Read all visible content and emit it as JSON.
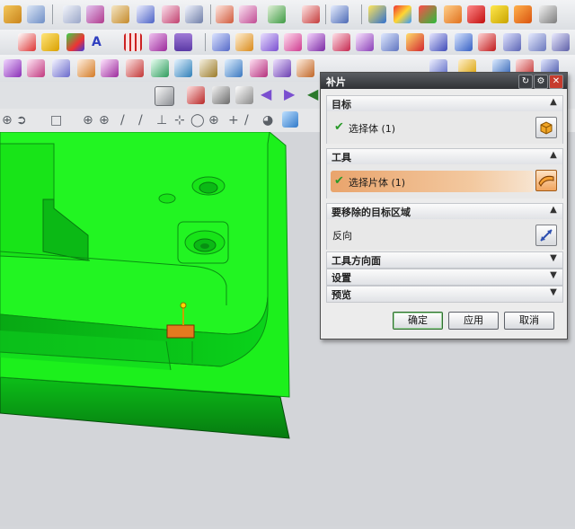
{
  "dialog": {
    "title": "补片",
    "sections": {
      "target": {
        "label": "目标",
        "select_label": "选择体 (1)"
      },
      "tool": {
        "label": "工具",
        "select_label": "选择片体 (1)"
      },
      "remove_region": {
        "label": "要移除的目标区域",
        "reverse_label": "反向"
      },
      "tool_face_dir": {
        "label": "工具方向面"
      },
      "settings": {
        "label": "设置"
      },
      "preview": {
        "label": "预览"
      }
    },
    "buttons": {
      "ok": "确定",
      "apply": "应用",
      "cancel": "取消"
    }
  },
  "colors": {
    "model": "#1cf01c",
    "model_dark": "#0a8f12",
    "highlight": "#e9a46c",
    "handle": "#e37a1f"
  }
}
